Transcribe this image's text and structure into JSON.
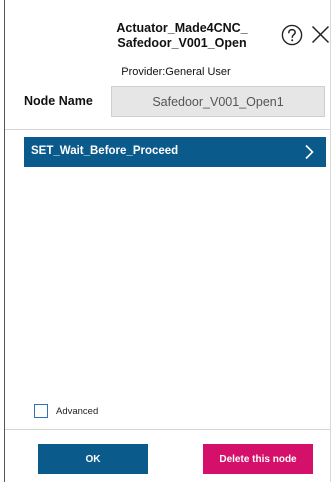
{
  "header": {
    "title_line1": "Actuator_Made4CNC_",
    "title_line2": "Safedoor_V001_Open",
    "help_icon": "help-circle-icon",
    "close_icon": "close-icon"
  },
  "provider": {
    "text": "Provider:General User"
  },
  "node_name": {
    "label": "Node Name",
    "value": "Safedoor_V001_Open1"
  },
  "list": {
    "items": [
      {
        "label": "SET_Wait_Before_Proceed",
        "icon": "chevron-right-icon"
      }
    ]
  },
  "advanced": {
    "label": "Advanced",
    "checked": false
  },
  "footer": {
    "ok_label": "OK",
    "delete_label": "Delete this node"
  },
  "colors": {
    "primary": "#0b5a8c",
    "danger": "#d4106b",
    "input_bg": "#e6e6e6"
  }
}
